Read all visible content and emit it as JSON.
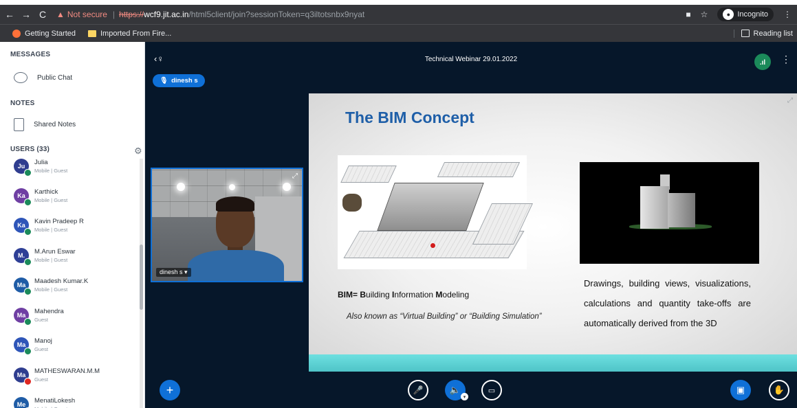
{
  "browser": {
    "not_secure": "Not secure",
    "url_scheme": "https://",
    "url_host": "wcf9.jit.ac.in",
    "url_path": "/html5client/join?sessionToken=q3iltotsnbx9nyat",
    "incognito": "Incognito"
  },
  "bookmarks": {
    "items": [
      "Getting Started",
      "Imported From Fire..."
    ],
    "reading_list": "Reading list"
  },
  "sidebar": {
    "messages_title": "MESSAGES",
    "public_chat": "Public Chat",
    "notes_title": "NOTES",
    "shared_notes": "Shared Notes",
    "users_title": "USERS (33)",
    "users": [
      {
        "initials": "Ju",
        "name": "Julia",
        "role": "Mobile | Guest",
        "color": "#2f3d8f",
        "badge": "green"
      },
      {
        "initials": "Ka",
        "name": "Karthick",
        "role": "Mobile | Guest",
        "color": "#6f3fa3",
        "badge": "green"
      },
      {
        "initials": "Ka",
        "name": "Kavin Pradeep R",
        "role": "Mobile | Guest",
        "color": "#2e55b8",
        "badge": "green"
      },
      {
        "initials": "M.",
        "name": "M.Arun Eswar",
        "role": "Mobile | Guest",
        "color": "#2e3f96",
        "badge": "green"
      },
      {
        "initials": "Ma",
        "name": "Maadesh Kumar.K",
        "role": "Mobile | Guest",
        "color": "#1f5ca6",
        "badge": "green"
      },
      {
        "initials": "Ma",
        "name": "Mahendra",
        "role": "Guest",
        "color": "#6f3fa3",
        "badge": "green"
      },
      {
        "initials": "Ma",
        "name": "Manoj",
        "role": "Guest",
        "color": "#2e55b8",
        "badge": "green"
      },
      {
        "initials": "Ma",
        "name": "MATHESWARAN.M.M",
        "role": "Guest",
        "color": "#2f3d8f",
        "badge": "red"
      },
      {
        "initials": "Me",
        "name": "MenatiLokesh",
        "role": "Mobile | Guest",
        "color": "#1f5ca6",
        "badge": "green"
      }
    ]
  },
  "meeting": {
    "title": "Technical Webinar 29.01.2022",
    "talker": "dinesh s",
    "camera_label": "dinesh s"
  },
  "slide": {
    "title": "The BIM Concept",
    "bim_def_parts": [
      "B",
      "IM= ",
      "B",
      "uilding ",
      "I",
      "nformation ",
      "M",
      "odeling"
    ],
    "aka": "Also known as “Virtual Building” or “Building Simulation”",
    "right_text": "Drawings, building views, visualizations, calculations and quantity take-offs are automatically derived from the 3D"
  },
  "colors": {
    "accent": "#0f70d7",
    "main_bg": "#06172a",
    "slide_title": "#1f5fa8"
  }
}
